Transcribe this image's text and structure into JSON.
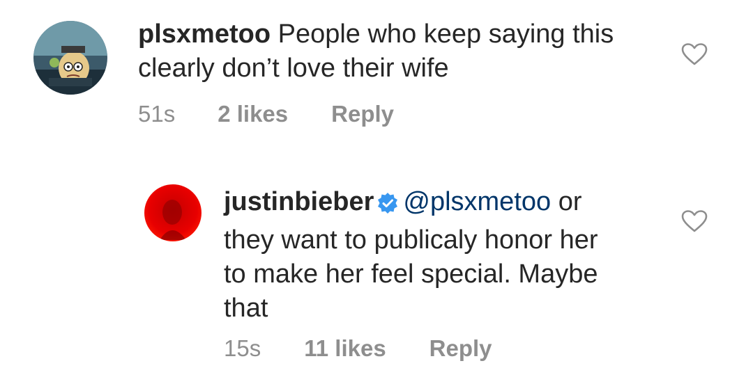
{
  "comments": [
    {
      "username": "plsxmetoo",
      "text_line1": "People who keep saying this",
      "text_line2": "clearly don’t love their wife",
      "time": "51s",
      "likes": "2 likes",
      "reply": "Reply",
      "avatar_icon": "cartoon-avatar-icon"
    },
    {
      "username": "justinbieber",
      "verified_icon": "verified-badge-icon",
      "mention": "@plsxmetoo",
      "text_line1_tail": "or",
      "text_line2": "they want to publicaly honor her",
      "text_line3": "to make her feel special. Maybe",
      "text_line4": "that",
      "time": "15s",
      "likes": "11 likes",
      "reply": "Reply",
      "avatar_icon": "red-avatar-icon"
    }
  ],
  "colors": {
    "text": "#262626",
    "meta": "#8e8e8e",
    "mention": "#003569",
    "verified": "#3897f0"
  }
}
